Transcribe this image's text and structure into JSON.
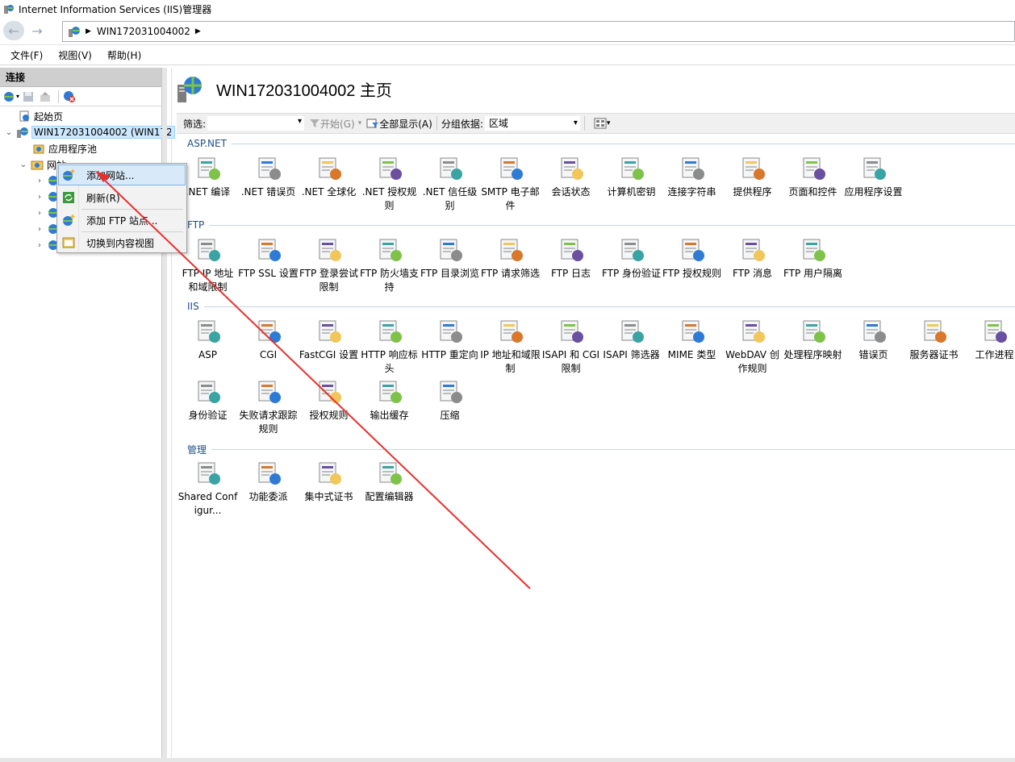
{
  "window": {
    "title": "Internet Information Services (IIS)管理器"
  },
  "address": {
    "crumb": "WIN172031004002"
  },
  "menubar": {
    "items": [
      "文件(F)",
      "视图(V)",
      "帮助(H)"
    ]
  },
  "connections": {
    "header": "连接",
    "tree": {
      "start_page": "起始页",
      "server": "WIN172031004002 (WIN172",
      "app_pools": "应用程序池",
      "sites": "网站"
    }
  },
  "context_menu": {
    "items": [
      "添加网站...",
      "刷新(R)",
      "添加 FTP 站点...",
      "切换到内容视图"
    ]
  },
  "main": {
    "title": "WIN172031004002 主页",
    "filter": {
      "label": "筛选:",
      "start": "开始(G)",
      "show_all": "全部显示(A)",
      "group_by_label": "分组依据:",
      "group_by_value": "区域"
    },
    "sections": {
      "aspnet": {
        "title": "ASP.NET",
        "items": [
          ".NET 编译",
          ".NET 错误页",
          ".NET 全球化",
          ".NET 授权规则",
          ".NET 信任级别",
          "SMTP 电子邮件",
          "会话状态",
          "计算机密钥",
          "连接字符串",
          "提供程序",
          "页面和控件",
          "应用程序设置"
        ]
      },
      "ftp": {
        "title": "FTP",
        "items": [
          "FTP IP 地址和域限制",
          "FTP SSL 设置",
          "FTP 登录尝试限制",
          "FTP 防火墙支持",
          "FTP 目录浏览",
          "FTP 请求筛选",
          "FTP 日志",
          "FTP 身份验证",
          "FTP 授权规则",
          "FTP 消息",
          "FTP 用户隔离"
        ]
      },
      "iis": {
        "title": "IIS",
        "items": [
          "ASP",
          "CGI",
          "FastCGI 设置",
          "HTTP 响应标头",
          "HTTP 重定向",
          "IP 地址和域限制",
          "ISAPI 和 CGI 限制",
          "ISAPI 筛选器",
          "MIME 类型",
          "WebDAV 创作规则",
          "处理程序映射",
          "错误页",
          "服务器证书",
          "工作进程",
          "身份验证",
          "失败请求跟踪规则",
          "授权规则",
          "输出缓存",
          "压缩"
        ]
      },
      "management": {
        "title": "管理",
        "items": [
          "Shared Configur...",
          "功能委派",
          "集中式证书",
          "配置编辑器"
        ]
      }
    }
  },
  "colors": {
    "annotation_arrow": "#e8302f",
    "section_title": "#1f4e8c",
    "selection": "#cde8ff"
  }
}
